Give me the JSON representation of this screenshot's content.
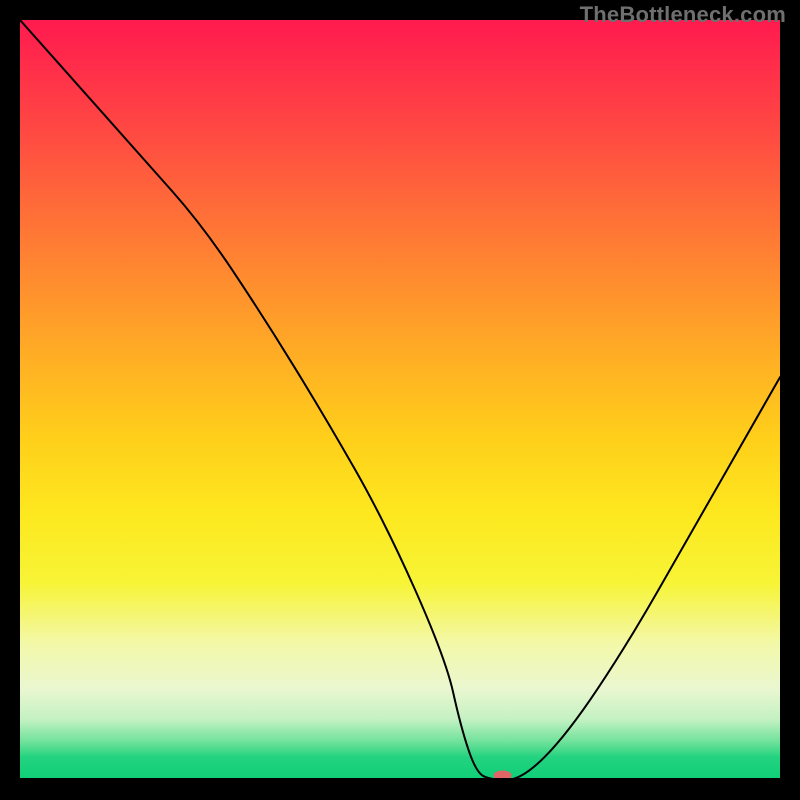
{
  "watermark": "TheBottleneck.com",
  "chart_data": {
    "type": "line",
    "title": "",
    "xlabel": "",
    "ylabel": "",
    "xlim": [
      0,
      100
    ],
    "ylim": [
      0,
      100
    ],
    "series": [
      {
        "name": "bottleneck-curve",
        "x": [
          0,
          8,
          16,
          24,
          32,
          40,
          48,
          56,
          58,
          60,
          62,
          66,
          72,
          80,
          88,
          96,
          100
        ],
        "y": [
          100,
          91,
          82,
          73,
          61,
          48,
          34,
          16,
          7,
          1,
          0,
          0,
          6,
          18,
          32,
          46,
          53
        ]
      }
    ],
    "marker": {
      "x": 63.5,
      "y": 0.6,
      "color": "#e06666",
      "rx": 9,
      "ry": 5
    },
    "gradient_stops": [
      {
        "pct": 0,
        "color": "#ff1a4f"
      },
      {
        "pct": 15,
        "color": "#ff4a42"
      },
      {
        "pct": 35,
        "color": "#ff8f2e"
      },
      {
        "pct": 55,
        "color": "#ffcf1a"
      },
      {
        "pct": 74,
        "color": "#f7f436"
      },
      {
        "pct": 88,
        "color": "#eaf7d0"
      },
      {
        "pct": 97,
        "color": "#23d27f"
      },
      {
        "pct": 100,
        "color": "#0ecf77"
      }
    ]
  }
}
